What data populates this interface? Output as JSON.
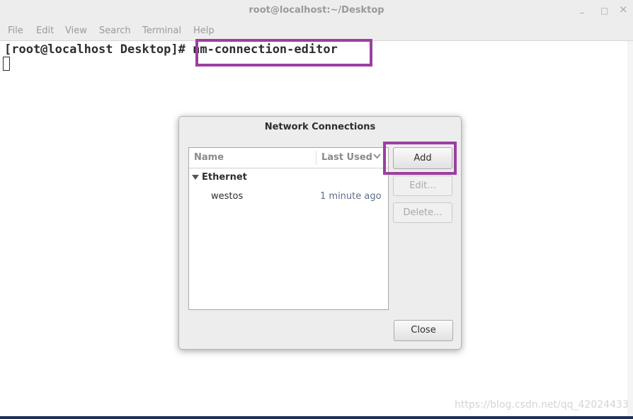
{
  "window": {
    "title": "root@localhost:~/Desktop",
    "minimize_glyph": "_",
    "maximize_glyph": "□",
    "close_glyph": "×"
  },
  "menubar": {
    "items": [
      "File",
      "Edit",
      "View",
      "Search",
      "Terminal",
      "Help"
    ]
  },
  "terminal": {
    "prompt": "[root@localhost Desktop]#",
    "command": " nm-connection-editor"
  },
  "dialog": {
    "title": "Network Connections",
    "columns": {
      "name": "Name",
      "last_used": "Last Used"
    },
    "groups": [
      {
        "label": "Ethernet",
        "connections": [
          {
            "name": "westos",
            "last_used": "1 minute ago"
          }
        ]
      }
    ],
    "buttons": {
      "add": "Add",
      "edit": "Edit...",
      "delete": "Delete...",
      "close": "Close"
    }
  },
  "watermark": "https://blog.csdn.net/qq_42024433",
  "colors": {
    "highlight": "#9b3fa0",
    "bottom_bar": "#1d2f55"
  }
}
